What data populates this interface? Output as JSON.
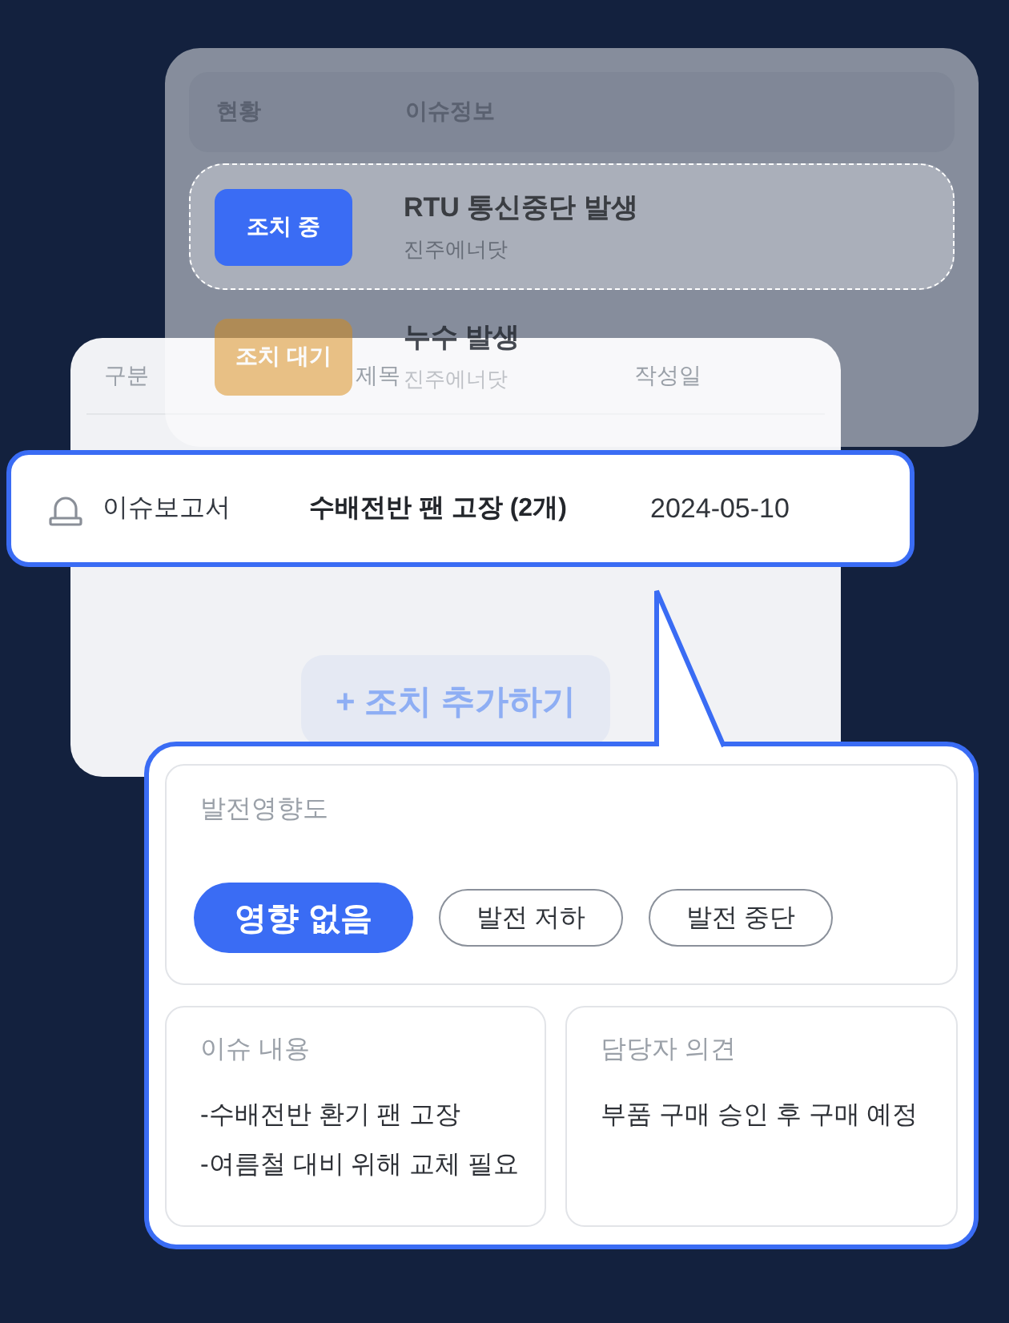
{
  "issue_board": {
    "columns": [
      "현황",
      "이슈정보"
    ],
    "rows": [
      {
        "status": "조치 중",
        "kind": "in_progress",
        "title": "RTU 통신중단 발생",
        "site": "진주에너닷",
        "selected": true
      },
      {
        "status": "조치 대기",
        "kind": "waiting",
        "title": "누수 발생",
        "site": "진주에너닷",
        "selected": false
      }
    ]
  },
  "report_list": {
    "columns": [
      "구분",
      "제목",
      "작성일"
    ],
    "add_button": "+ 조치 추가하기"
  },
  "highlighted_report": {
    "category": "이슈보고서",
    "title": "수배전반 팬 고장 (2개)",
    "date": "2024-05-10"
  },
  "detail": {
    "impact": {
      "label": "발전영향도",
      "options": [
        {
          "label": "영향 없음",
          "selected": true
        },
        {
          "label": "발전 저하",
          "selected": false
        },
        {
          "label": "발전 중단",
          "selected": false
        }
      ]
    },
    "issue_content": {
      "label": "이슈 내용",
      "lines": [
        "-수배전반 환기 팬 고장",
        "-여름철 대비 위해 교체 필요"
      ]
    },
    "manager_opinion": {
      "label": "담당자 의견",
      "lines": [
        "부품 구매 승인 후 구매 예정"
      ]
    }
  }
}
